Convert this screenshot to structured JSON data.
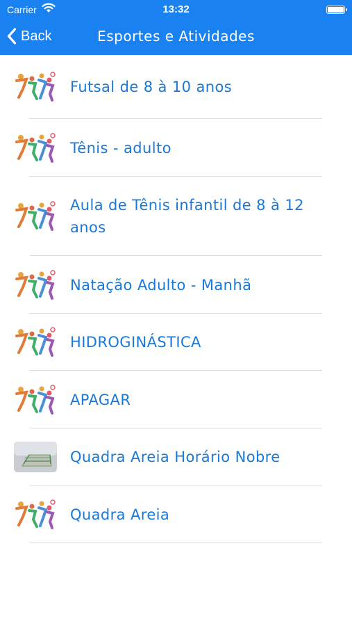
{
  "status_bar": {
    "carrier": "Carrier",
    "time": "13:32"
  },
  "nav": {
    "back_label": "Back",
    "title": "Esportes e Atividades"
  },
  "colors": {
    "nav_background": "#1a82f0",
    "item_text": "#1a78d8",
    "separator": "#dcdcdc"
  },
  "items": [
    {
      "label": "Futsal de 8 à 10 anos",
      "icon": "sports-people-icon"
    },
    {
      "label": "Tênis - adulto",
      "icon": "sports-people-icon"
    },
    {
      "label": "Aula de Tênis infantil de 8 à 12 anos",
      "icon": "sports-people-icon"
    },
    {
      "label": "Natação Adulto - Manhã",
      "icon": "sports-people-icon"
    },
    {
      "label": "HIDROGINÁSTICA",
      "icon": "sports-people-icon"
    },
    {
      "label": "APAGAR",
      "icon": "sports-people-icon"
    },
    {
      "label": "Quadra Areia Horário Nobre",
      "icon": "court-photo-icon"
    },
    {
      "label": "Quadra Areia",
      "icon": "sports-people-icon"
    }
  ]
}
